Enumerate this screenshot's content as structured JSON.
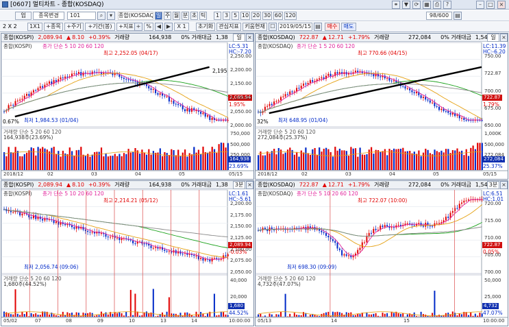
{
  "window": {
    "title": "[0607] 멀티차트 - 종합(KOSDAQ)",
    "help": "?"
  },
  "toolbar1": {
    "mode": "업",
    "dropdown": "종목변경",
    "code": "101",
    "market": "종합(KOSDAQ)",
    "tabs": [
      "일",
      "주",
      "월",
      "분",
      "초",
      "틱"
    ],
    "periods": [
      "1",
      "3",
      "5",
      "10",
      "20",
      "30",
      "60",
      "120"
    ],
    "count": "98/600"
  },
  "toolbar2": {
    "layout": "2 X 2",
    "grid_label": "1X1",
    "items": [
      "+종목",
      "+주기",
      "+기간(봉)",
      "+지표"
    ],
    "pct": "%",
    "x_label": "X 1",
    "reset": "초기화",
    "interest": "관심지표",
    "bright": "키움현재",
    "date": "2019/05/15",
    "buy": "매수",
    "sell": "매도"
  },
  "panels": [
    {
      "id": "p1",
      "name": "종합(KOSPI)",
      "price": "2,089.94",
      "change": "8.10",
      "pct": "+0.39%",
      "vol_label": "거래량",
      "vol": "164,938",
      "amount_label": "0% 거래대금",
      "amount": "1,38",
      "period": "일",
      "legend": "종합(KOSPI)",
      "ma": "종가 단순 5 10 20 60 120",
      "hi": "최고 2,252.05 (04/17)",
      "lo": "최저 1,984.53 (01/04)",
      "pctl": "0.67%",
      "lc": "LC:5.31",
      "hc": "HC:-7.20",
      "last": "2,089.94",
      "lastpct": "1.95%",
      "trend_end": "2,195",
      "yticks": [
        "2,250.00",
        "2,200.00",
        "2,150.00",
        "2,100.00",
        "2,050.00",
        "2,000.00"
      ],
      "vol_legend": "거래량 단순 5 20 60 120",
      "vol_val": "164,938주(23.69%)",
      "vyticks": [
        "750,000",
        "500,000",
        "250,000"
      ],
      "vlast": "164,938",
      "vlastpct": "23.69%",
      "xticks": [
        "2018/12",
        "02",
        "03",
        "04",
        "05",
        "05/15"
      ]
    },
    {
      "id": "p2",
      "name": "종합(KOSDAQ)",
      "price": "722.87",
      "change": "12.71",
      "pct": "+1.79%",
      "vol_label": "거래량",
      "vol": "272,084",
      "amount_label": "0% 거래대금",
      "amount": "1,54",
      "period": "일",
      "legend": "종합(KOSDAQ)",
      "ma": "종가 단순 1 5 20 60 120",
      "hi": "최고 770.66 (04/15)",
      "lo": "최저 648.95 (01/04)",
      "pctl": "32%",
      "lc": "LC:11.39",
      "hc": "HC:-6.20",
      "last": "722.87",
      "lastpct": "1.79%",
      "yticks": [
        "750.00",
        "722.87",
        "700.00",
        "675.00",
        "650.00"
      ],
      "vol_legend": "거래량 단순 5 20 60 120",
      "vol_val": "272,084주(25.37%)",
      "vyticks": [
        "1,000K",
        "500,000",
        "272,084"
      ],
      "vlast": "272,084",
      "vlastpct": "25.37%",
      "xticks": [
        "2018/12",
        "02",
        "03",
        "04",
        "05",
        "05/15"
      ]
    },
    {
      "id": "p3",
      "name": "종합(KOSPI)",
      "price": "2,089.94",
      "change": "8.10",
      "pct": "+0.39%",
      "vol_label": "거래량",
      "vol": "164,938",
      "amount_label": "0% 거래대금",
      "amount": "1,38",
      "period": "3분",
      "legend": "종합(KOSPI)",
      "ma": "종가 단순 5 10 20 60 120",
      "hi": "최고 2,214.21 (05/12)",
      "lo": "최저 2,056.74 (09:06)",
      "lc": "LC:1.61",
      "hc": "HC:-5.61",
      "last": "2,089.94",
      "lastpct": "-0.03%",
      "yticks": [
        "2,200.00",
        "2,175.00",
        "2,150.00",
        "2,125.00",
        "2,100.00",
        "2,075.00",
        "2,050.00"
      ],
      "vol_legend": "거래량 단순 5 20 60 120",
      "vol_val": "1,680주(44.52%)",
      "vyticks": [
        "40,000",
        "20,000"
      ],
      "vlast": "1,680",
      "vlastpct": "44.52%",
      "xticks": [
        "05/02",
        "07",
        "08",
        "09",
        "10",
        "13",
        "14",
        "10:00:00"
      ]
    },
    {
      "id": "p4",
      "name": "종합(KOSDAQ)",
      "price": "722.87",
      "change": "12.71",
      "pct": "+1.79%",
      "vol_label": "거래량",
      "vol": "272,084",
      "amount_label": "0% 거래대금",
      "amount": "1,54",
      "period": "3분",
      "legend": "종합(KOSDAQ)",
      "ma": "종가 단순 5 10 20 60 120",
      "hi": "최고 722.07 (10:00)",
      "lo": "최저 698.30 (09:09)",
      "lc": "LC:6.51",
      "hc": "HC:1.01",
      "last": "722.87",
      "lastpct": "0.05%",
      "yticks": [
        "720.00",
        "715.00",
        "710.00",
        "705.00",
        "700.00"
      ],
      "vol_legend": "거래량 단순 5 20 60 120",
      "vol_val": "4,732주(47.07%)",
      "vyticks": [
        "50,000",
        "25,000"
      ],
      "vlast": "4,732",
      "vlastpct": "47.07%",
      "xticks": [
        "05/13",
        "14",
        "15",
        "10:00:00"
      ]
    }
  ],
  "colors": {
    "up": "#e10000",
    "down": "#0029c8",
    "ma5": "#e0209a",
    "ma10": "#1a3cd0",
    "ma20": "#e5a010",
    "ma60": "#18a018",
    "ma120": "#888888",
    "trend": "#000000",
    "frame": "#7f8fa8"
  }
}
